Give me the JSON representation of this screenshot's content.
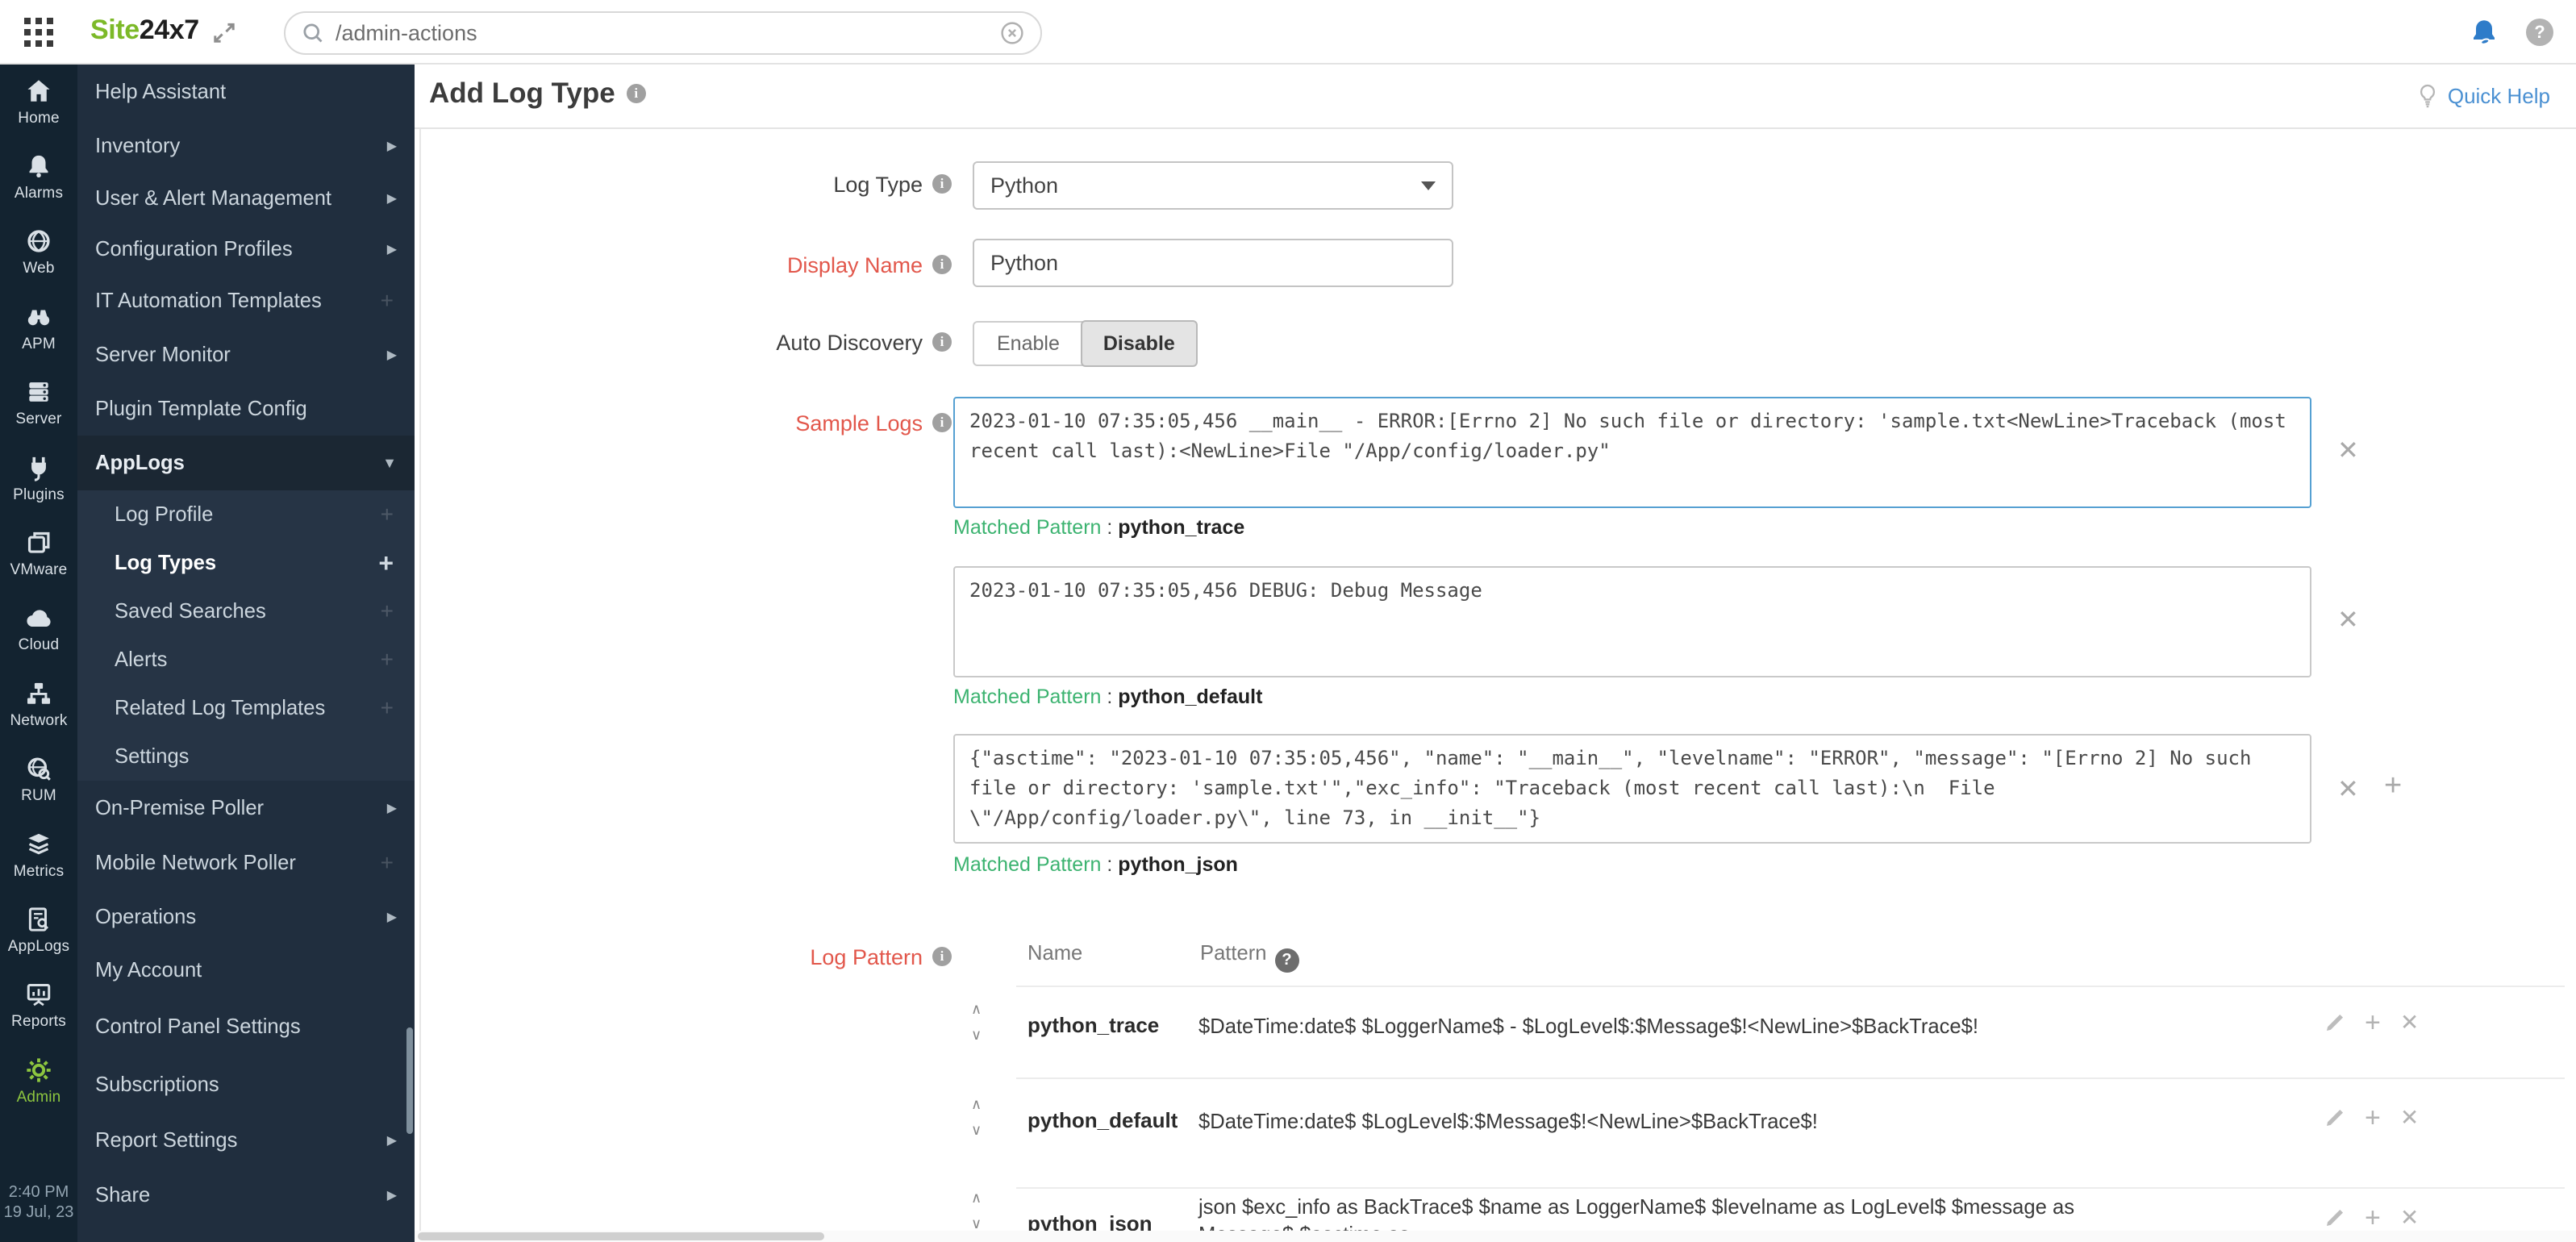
{
  "topbar": {
    "logo_site": "Site",
    "logo_24x7": "24x7",
    "search_value": "/admin-actions"
  },
  "rail": {
    "items": [
      {
        "label": "Home"
      },
      {
        "label": "Alarms"
      },
      {
        "label": "Web"
      },
      {
        "label": "APM"
      },
      {
        "label": "Server"
      },
      {
        "label": "Plugins"
      },
      {
        "label": "VMware"
      },
      {
        "label": "Cloud"
      },
      {
        "label": "Network"
      },
      {
        "label": "RUM"
      },
      {
        "label": "Metrics"
      },
      {
        "label": "AppLogs"
      },
      {
        "label": "Reports"
      },
      {
        "label": "Admin"
      }
    ],
    "time": "2:40 PM",
    "date": "19 Jul, 23"
  },
  "sidebar": {
    "items": [
      {
        "label": "Help Assistant"
      },
      {
        "label": "Inventory"
      },
      {
        "label": "User & Alert Management"
      },
      {
        "label": "Configuration Profiles"
      },
      {
        "label": "IT Automation Templates"
      },
      {
        "label": "Server Monitor"
      },
      {
        "label": "Plugin Template Config"
      },
      {
        "label": "AppLogs"
      },
      {
        "label": "Log Profile"
      },
      {
        "label": "Log Types"
      },
      {
        "label": "Saved Searches"
      },
      {
        "label": "Alerts"
      },
      {
        "label": "Related Log Templates"
      },
      {
        "label": "Settings"
      },
      {
        "label": "On-Premise Poller"
      },
      {
        "label": "Mobile Network Poller"
      },
      {
        "label": "Operations"
      },
      {
        "label": "My Account"
      },
      {
        "label": "Control Panel Settings"
      },
      {
        "label": "Subscriptions"
      },
      {
        "label": "Report Settings"
      },
      {
        "label": "Share"
      }
    ]
  },
  "content": {
    "title": "Add Log Type",
    "quick_help": "Quick Help",
    "form": {
      "log_type_label": "Log Type",
      "log_type_value": "Python",
      "display_name_label": "Display Name",
      "display_name_value": "Python",
      "auto_discovery_label": "Auto Discovery",
      "enable_label": "Enable",
      "disable_label": "Disable",
      "sample_logs_label": "Sample Logs",
      "matched_pattern_label": "Matched Pattern",
      "samples": [
        {
          "text": "2023-01-10 07:35:05,456 __main__ - ERROR:[Errno 2] No such file or directory: 'sample.txt<NewLine>Traceback (most recent call last):<NewLine>File \"/App/config/loader.py\"",
          "matched": "python_trace"
        },
        {
          "text": "2023-01-10 07:35:05,456 DEBUG: Debug Message",
          "matched": "python_default"
        },
        {
          "text": "{\"asctime\": \"2023-01-10 07:35:05,456\", \"name\": \"__main__\", \"levelname\": \"ERROR\", \"message\": \"[Errno 2] No such file or directory: 'sample.txt'\",\"exc_info\": \"Traceback (most recent call last):\\n  File \\\"/App/config/loader.py\\\", line 73, in __init__\"}",
          "matched": "python_json"
        }
      ],
      "log_pattern_label": "Log Pattern",
      "table": {
        "col_name": "Name",
        "col_pattern": "Pattern",
        "rows": [
          {
            "name": "python_trace",
            "pattern": "$DateTime:date$ $LoggerName$ - $LogLevel$:$Message$!<NewLine>$BackTrace$!"
          },
          {
            "name": "python_default",
            "pattern": "$DateTime:date$ $LogLevel$:$Message$!<NewLine>$BackTrace$!"
          },
          {
            "name": "python_json",
            "pattern": "json $exc_info as BackTrace$ $name as LoggerName$ $levelname as LogLevel$ $message as Message$ $asctime as"
          }
        ]
      }
    }
  }
}
